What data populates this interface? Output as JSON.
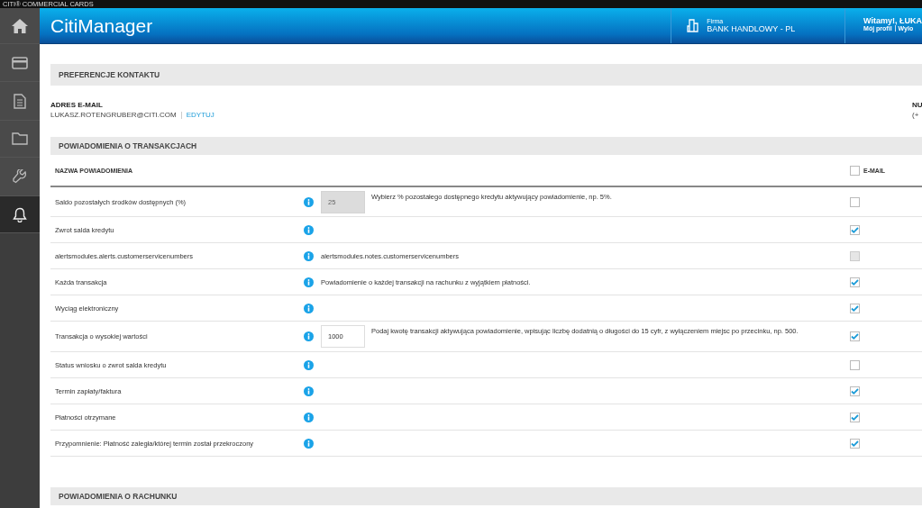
{
  "top_strip": {
    "brand": "CITI® COMMERCIAL CARDS"
  },
  "sidebar": {
    "items": [
      {
        "selected": false
      },
      {
        "selected": false
      },
      {
        "selected": false
      },
      {
        "selected": false
      },
      {
        "selected": false
      },
      {
        "selected": true
      }
    ]
  },
  "header": {
    "title": "CitiManager",
    "company_label": "Firma",
    "company": "BANK HANDLOWY - PL",
    "welcome": "Witamy!, ŁUKA",
    "profile_link": "Mój profil",
    "logout_link": "Wylo"
  },
  "contact_preferences": {
    "heading": "PREFERENCJE KONTAKTU",
    "email_label": "ADRES E-MAIL",
    "email": "LUKASZ.ROTENGRUBER@CITI.COM",
    "edit_link": "EDYTUJ",
    "phone_label": "NU",
    "phone": "(+"
  },
  "transaction_alerts": {
    "heading": "POWIADOMIENIA O TRANSAKCJACH",
    "name_column": "NAZWA POWIADOMIENIA",
    "email_column": "E-MAIL",
    "email_all_checked": false,
    "rows": [
      {
        "name": "Saldo pozostałych środków dostępnych (%)",
        "kind": "field",
        "field": {
          "value": "25",
          "disabled": true
        },
        "description": "Wybierz % pozostałego dostępnego kredytu aktywujący powiadomienie, np. 5%.",
        "checked": false,
        "disabled": false
      },
      {
        "name": "Zwrot salda kredytu",
        "kind": "plain",
        "checked": true,
        "disabled": false
      },
      {
        "name": "alertsmodules.alerts.customerservicenumbers",
        "kind": "plain",
        "description": "alertsmodules.notes.customerservicenumbers",
        "checked": false,
        "disabled": true
      },
      {
        "name": "Każda transakcja",
        "kind": "plain",
        "description": "Powiadomienie o każdej transakcji na rachunku z wyjątkiem płatności.",
        "checked": true,
        "disabled": false
      },
      {
        "name": "Wyciąg elektroniczny",
        "kind": "plain",
        "checked": true,
        "disabled": false
      },
      {
        "name": "Transakcja o wysokiej wartości",
        "kind": "field",
        "field": {
          "value": "1000",
          "disabled": false
        },
        "description": "Podaj kwotę transakcji aktywująca powiadomienie, wpisując liczbę dodatnią o długości do 15 cyfr, z wyłączeniem miejsc po przecinku, np. 500.",
        "checked": true,
        "disabled": false
      },
      {
        "name": "Status wniosku o zwrot salda kredytu",
        "kind": "plain",
        "checked": false,
        "disabled": false
      },
      {
        "name": "Termin zapłaty/faktura",
        "kind": "plain",
        "checked": true,
        "disabled": false
      },
      {
        "name": "Płatności otrzymane",
        "kind": "plain",
        "checked": true,
        "disabled": false
      },
      {
        "name": "Przypomnienie: Płatność zaległa/której termin został przekroczony",
        "kind": "plain",
        "checked": true,
        "disabled": false
      }
    ]
  },
  "account_alerts": {
    "heading": "POWIADOMIENIA O RACHUNKU"
  }
}
